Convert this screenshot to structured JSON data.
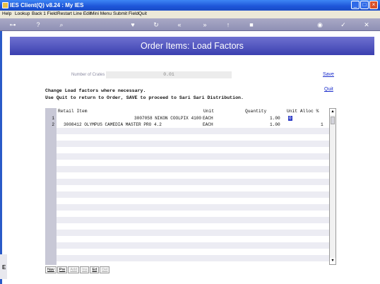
{
  "window": {
    "title": "IES Client(Q) v8.24 : My IES"
  },
  "menu": [
    "Help",
    "Lookup",
    "Back 1 Field",
    "Restart Line Edit",
    "Mini Menu",
    "Submit Field",
    "Quit"
  ],
  "toolbar_icons": [
    "key-icon",
    "help-icon",
    "search-icon",
    "heart-icon",
    "refresh-icon",
    "rewind-icon",
    "fast-forward-icon",
    "cursor-icon",
    "stop-icon",
    "globe-icon",
    "check-icon",
    "close-icon"
  ],
  "page": {
    "title": "Order Items: Load Factors",
    "crates_label": "Number of Crates",
    "crates_value": "0.01",
    "save_label": "Save",
    "quit_label": "Quit",
    "instruction_1": "Change Load factors where necessary.",
    "instruction_2": "Use Quit to return to Order, SAVE to proceed to Sari Sari Distribution."
  },
  "table": {
    "columns": [
      "Retail Item",
      "Unit",
      "Quantity",
      "Unit Alloc %"
    ],
    "rows": [
      {
        "num": "1",
        "item": "3007058 NIKON COOLPIX 4100",
        "unit": "EACH",
        "qty": "1.00",
        "alloc": "0"
      },
      {
        "num": "2",
        "item": "3008412 OLYMPUS CAMEDIA MASTER PRO 4.2",
        "unit": "EACH",
        "qty": "1.00",
        "alloc": "1"
      }
    ]
  },
  "nav": [
    "Nav",
    "Pre",
    "Add",
    "Ins",
    "Ed",
    "Del"
  ],
  "colors": {
    "accent": "#3b3fb0",
    "link": "#1a2dcc"
  }
}
